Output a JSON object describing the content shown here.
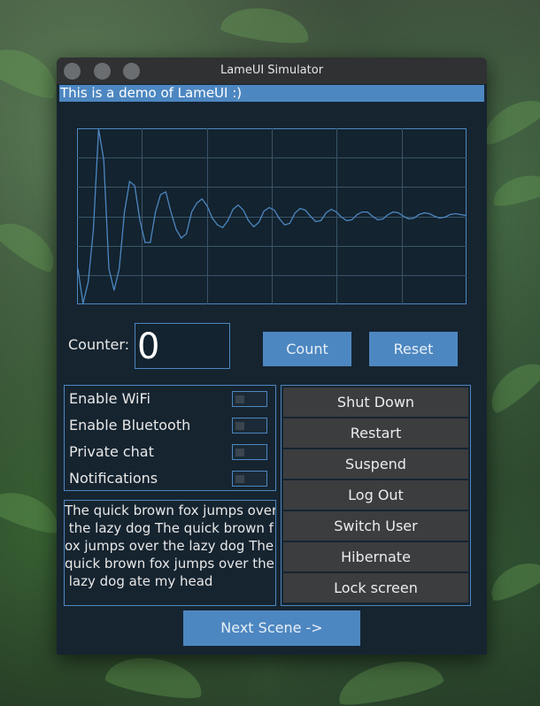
{
  "window": {
    "title": "LameUI Simulator"
  },
  "banner": {
    "text": "This is a demo of LameUI :)"
  },
  "chart_data": {
    "type": "line",
    "title": "",
    "xlabel": "",
    "ylabel": "",
    "grid": true,
    "legend": "none",
    "ylim": [
      -1,
      1
    ],
    "x": [
      0,
      1,
      2,
      3,
      4,
      5,
      6,
      7,
      8,
      9,
      10,
      11,
      12,
      13,
      14,
      15,
      16,
      17,
      18,
      19,
      20,
      21,
      22,
      23,
      24,
      25,
      26,
      27,
      28,
      29,
      30,
      31,
      32,
      33,
      34,
      35,
      36,
      37,
      38,
      39,
      40,
      41,
      42,
      43,
      44,
      45,
      46,
      47,
      48,
      49,
      50,
      51,
      52,
      53,
      54,
      55,
      56,
      57,
      58,
      59,
      60,
      61,
      62,
      63,
      64,
      65,
      66,
      67,
      68,
      69,
      70,
      71,
      72,
      73,
      74,
      75
    ],
    "series": [
      {
        "values": [
          -0.6,
          -1.0,
          -0.75,
          -0.15,
          1.0,
          0.65,
          -0.6,
          -0.85,
          -0.6,
          0.05,
          0.4,
          0.35,
          -0.05,
          -0.3,
          -0.3,
          0.05,
          0.25,
          0.28,
          0.05,
          -0.15,
          -0.25,
          -0.2,
          0.05,
          0.15,
          0.2,
          0.12,
          -0.02,
          -0.1,
          -0.13,
          -0.05,
          0.08,
          0.13,
          0.07,
          -0.05,
          -0.12,
          -0.07,
          0.06,
          0.1,
          0.07,
          -0.03,
          -0.1,
          -0.08,
          0.04,
          0.09,
          0.07,
          0.0,
          -0.06,
          -0.05,
          0.04,
          0.08,
          0.05,
          -0.01,
          -0.05,
          -0.04,
          0.02,
          0.05,
          0.05,
          0.0,
          -0.04,
          -0.03,
          0.02,
          0.05,
          0.04,
          0.0,
          -0.03,
          -0.02,
          0.02,
          0.04,
          0.03,
          0.0,
          -0.02,
          -0.01,
          0.02,
          0.03,
          0.02,
          0.01
        ]
      }
    ]
  },
  "counter": {
    "label": "Counter:",
    "value": "0"
  },
  "buttons": {
    "count": "Count",
    "reset": "Reset",
    "next_scene": "Next Scene ->"
  },
  "toggles": [
    {
      "label": "Enable WiFi",
      "on": false
    },
    {
      "label": "Enable Bluetooth",
      "on": false
    },
    {
      "label": "Private chat",
      "on": false
    },
    {
      "label": "Notifications",
      "on": false
    }
  ],
  "textbox": {
    "lines": [
      "The quick brown fox jumps over",
      " the lazy dog The quick brown f",
      "ox jumps over the lazy dog The",
      "quick brown fox jumps over the",
      " lazy dog ate my head"
    ]
  },
  "menu": {
    "items": [
      "Shut Down",
      "Restart",
      "Suspend",
      "Log Out",
      "Switch User",
      "Hibernate",
      "Lock screen"
    ]
  },
  "colors": {
    "accent": "#4d87c1",
    "window_bg": "#162430",
    "menu_item_bg": "#3b3d3f",
    "titlebar_bg": "#2f3133"
  }
}
